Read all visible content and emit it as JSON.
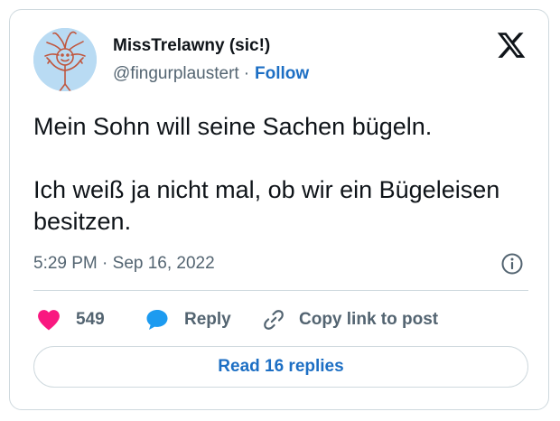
{
  "author": {
    "display_name": "MissTrelawny (sic!)",
    "handle": "@fingurplaustert",
    "separator": "·",
    "follow_label": "Follow",
    "avatar_icon": "stick-figure-doodle-avatar"
  },
  "platform": {
    "logo_icon": "x-logo-icon"
  },
  "tweet": {
    "paragraphs": [
      "Mein Sohn will seine Sachen bügeln.",
      "Ich weiß ja nicht mal, ob wir ein Bügeleisen besitzen."
    ],
    "timestamp": "5:29 PM · Sep 16, 2022"
  },
  "actions": {
    "like_count": "549",
    "reply_label": "Reply",
    "copy_link_label": "Copy link to post"
  },
  "replies_button_label": "Read 16 replies",
  "colors": {
    "text": "#0f1419",
    "secondary_text": "#536471",
    "link_blue": "#1d6fc4",
    "like_pink": "#f91880",
    "reply_blue": "#1d9bf0",
    "border": "#cfd9de",
    "avatar_bg": "#b9dbf3"
  }
}
